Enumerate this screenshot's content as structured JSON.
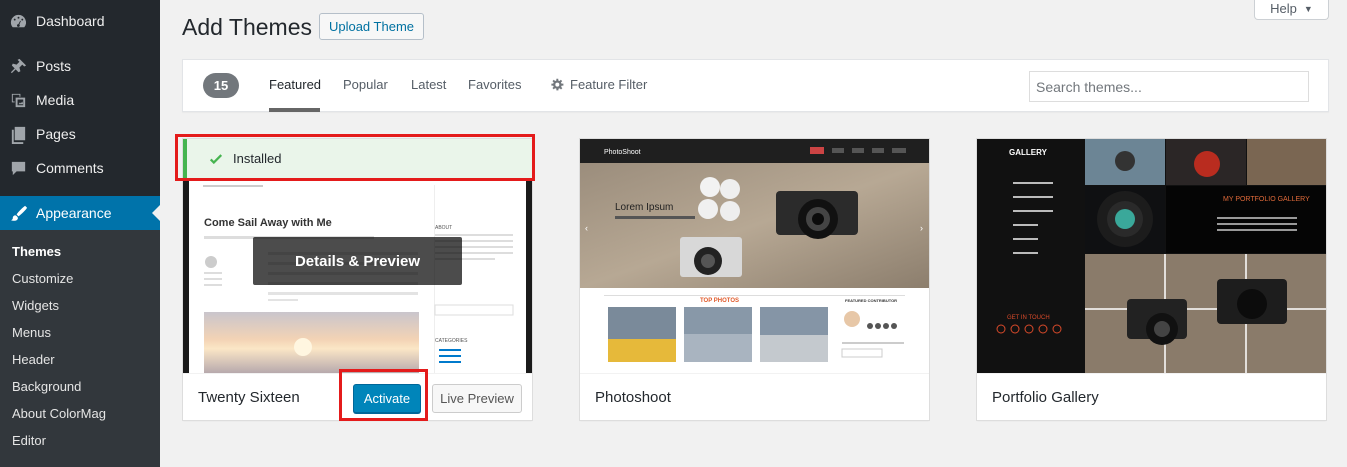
{
  "sidebar": {
    "items": [
      {
        "label": "Dashboard",
        "icon": "dashboard-icon"
      },
      {
        "label": "Posts",
        "icon": "pushpin-icon"
      },
      {
        "label": "Media",
        "icon": "media-icon"
      },
      {
        "label": "Pages",
        "icon": "pages-icon"
      },
      {
        "label": "Comments",
        "icon": "comments-icon"
      },
      {
        "label": "Appearance",
        "icon": "paintbrush-icon"
      }
    ],
    "submenu": [
      "Themes",
      "Customize",
      "Widgets",
      "Menus",
      "Header",
      "Background",
      "About ColorMag",
      "Editor"
    ]
  },
  "header": {
    "title": "Add Themes",
    "upload_label": "Upload Theme",
    "help_label": "Help"
  },
  "filter_bar": {
    "count": "15",
    "tabs": [
      "Featured",
      "Popular",
      "Latest",
      "Favorites"
    ],
    "feature_filter_label": "Feature Filter",
    "search_placeholder": "Search themes..."
  },
  "themes": [
    {
      "name": "Twenty Sixteen",
      "installed_label": "Installed",
      "details_label": "Details & Preview",
      "activate_label": "Activate",
      "live_preview_label": "Live Preview",
      "preview": {
        "post_title": "Come Sail Away with Me",
        "sidebar_heading_1": "ABOUT",
        "sidebar_heading_2": "CATEGORIES"
      }
    },
    {
      "name": "Photoshoot",
      "preview": {
        "brand": "PhotoShoot",
        "hero_title": "Lorem Ipsum",
        "section_title": "TOP PHOTOS",
        "contributor_heading": "FEATURED CONTRIBUTOR"
      }
    },
    {
      "name": "Portfolio Gallery",
      "preview": {
        "logo": "GALLERY",
        "heading": "MY PORTFOLIO GALLERY",
        "contact": "GET IN TOUCH"
      }
    }
  ],
  "colors": {
    "sidebar_bg": "#23282d",
    "accent": "#0073aa",
    "installed_green": "#46b450",
    "annotation_red": "#e41b1b"
  }
}
